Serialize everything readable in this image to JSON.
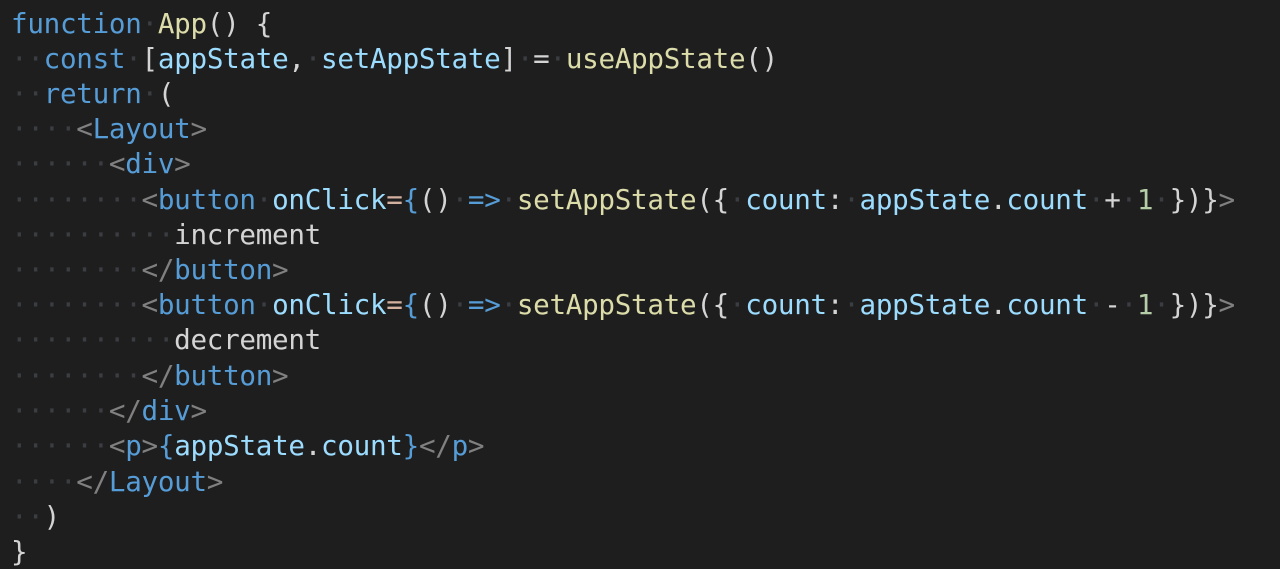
{
  "code": {
    "l1": {
      "kw": "function",
      "fn": "App",
      "rest": "() {"
    },
    "l2": {
      "kw": "const",
      "open": "[",
      "v1": "appState",
      "comma": ",",
      "v2": "setAppState",
      "close": "]",
      "eq": "=",
      "fn": "useAppState",
      "call": "()"
    },
    "l3": {
      "kw": "return",
      "paren": "("
    },
    "l4": {
      "lt": "<",
      "tag": "Layout",
      "gt": ">"
    },
    "l5": {
      "lt": "<",
      "tag": "div",
      "gt": ">"
    },
    "l6": {
      "lt": "<",
      "tag": "button",
      "attr": "onClick",
      "eq": "=",
      "ob": "{",
      "args": "()",
      "arrow": "=>",
      "fn": "setAppState",
      "op": "({",
      "key": "count",
      "colon": ":",
      "obj": "appState",
      "dot": ".",
      "prop": "count",
      "oper": "+",
      "num": "1",
      "cb": "})}",
      "gt": ">"
    },
    "l7": {
      "text": "increment"
    },
    "l8": {
      "lt": "</",
      "tag": "button",
      "gt": ">"
    },
    "l9": {
      "lt": "<",
      "tag": "button",
      "attr": "onClick",
      "eq": "=",
      "ob": "{",
      "args": "()",
      "arrow": "=>",
      "fn": "setAppState",
      "op": "({",
      "key": "count",
      "colon": ":",
      "obj": "appState",
      "dot": ".",
      "prop": "count",
      "oper": "-",
      "num": "1",
      "cb": "})}",
      "gt": ">"
    },
    "l10": {
      "text": "decrement"
    },
    "l11": {
      "lt": "</",
      "tag": "button",
      "gt": ">"
    },
    "l12": {
      "lt": "</",
      "tag": "div",
      "gt": ">"
    },
    "l13": {
      "lt": "<",
      "tag": "p",
      "gt": ">",
      "ob": "{",
      "obj": "appState",
      "dot": ".",
      "prop": "count",
      "cb": "}",
      "lt2": "</",
      "tag2": "p",
      "gt2": ">"
    },
    "l14": {
      "lt": "</",
      "tag": "Layout",
      "gt": ">"
    },
    "l15": {
      "paren": ")"
    },
    "l16": {
      "brace": "}"
    }
  }
}
